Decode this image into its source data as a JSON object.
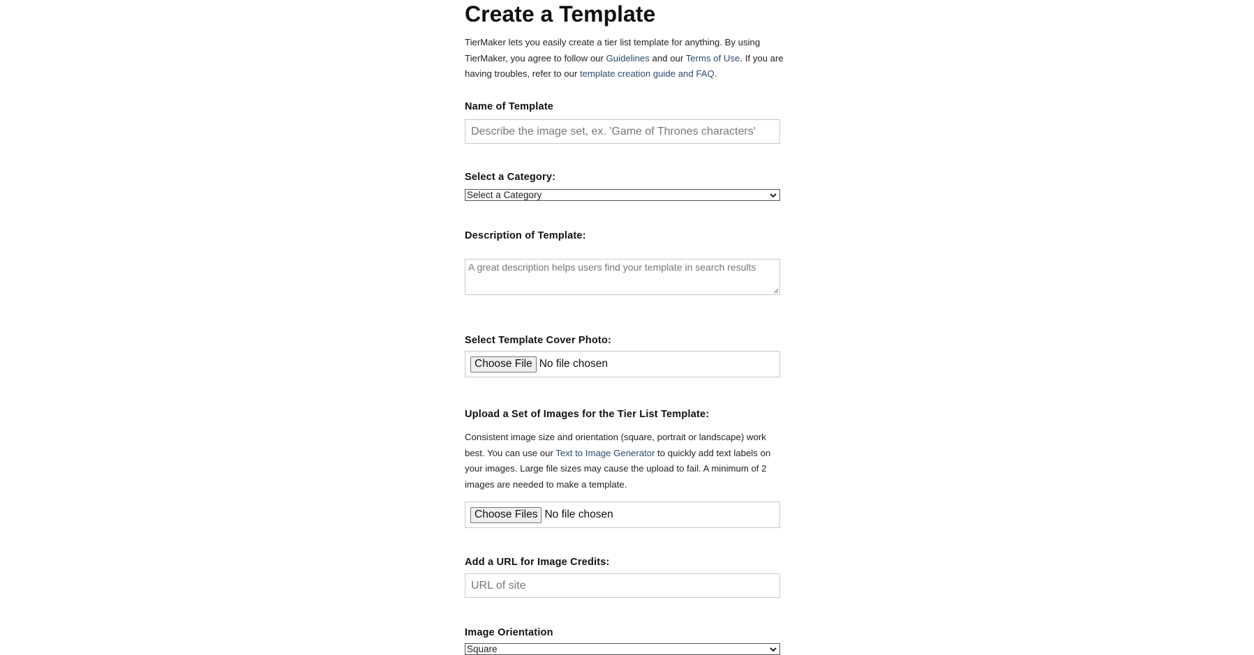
{
  "page": {
    "title": "Create a Template",
    "intro": {
      "part1": "TierMaker lets you easily create a tier list template for anything. By using TierMaker, you agree to follow our ",
      "link_guidelines": "Guidelines",
      "part2": " and our ",
      "link_terms": "Terms of Use",
      "part3": ". If you are having troubles, refer to our ",
      "link_guide": "template creation guide and FAQ",
      "part4": "."
    }
  },
  "form": {
    "name": {
      "label": "Name of Template",
      "placeholder": "Describe the image set, ex. 'Game of Thrones characters'",
      "value": ""
    },
    "category": {
      "label": "Select a Category:",
      "selected": "Select a Category"
    },
    "description": {
      "label": "Description of Template:",
      "placeholder": "A great description helps users find your template in search results",
      "value": ""
    },
    "cover_photo": {
      "label": "Select Template Cover Photo:",
      "button": "Choose File",
      "status": "No file chosen"
    },
    "images": {
      "label": "Upload a Set of Images for the Tier List Template:",
      "help": {
        "part1": "Consistent image size and orientation (square, portrait or landscape) work best. You can use our ",
        "link_generator": "Text to Image Generator",
        "part2": " to quickly add text labels on your images. Large file sizes may cause the upload to fail. A minimum of 2 images are needed to make a template."
      },
      "button": "Choose Files",
      "status": "No file chosen"
    },
    "credits_url": {
      "label": "Add a URL for Image Credits:",
      "placeholder": "URL of site",
      "value": ""
    },
    "orientation": {
      "label": "Image Orientation",
      "selected": "Square"
    }
  },
  "colors": {
    "link": "#2c4a6e",
    "text": "#111111",
    "border": "#c8c8c8"
  }
}
